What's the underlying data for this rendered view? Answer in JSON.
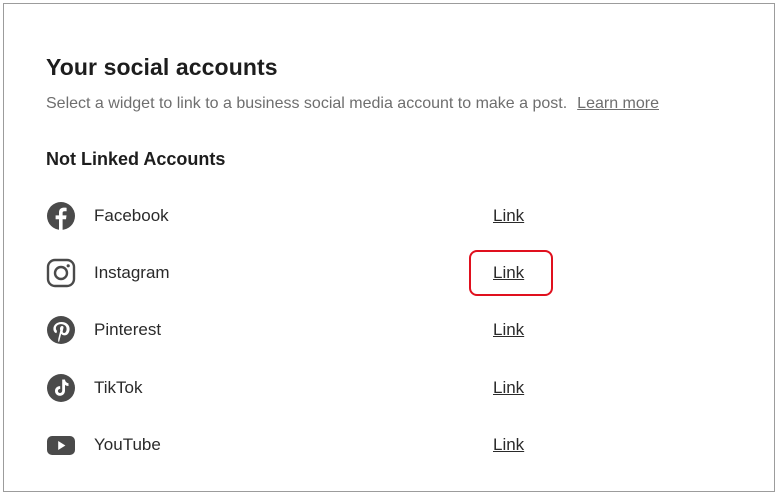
{
  "panel": {
    "title": "Your social accounts",
    "subtitle": "Select a widget to link to a business social media account to make a post.",
    "learn_more": "Learn more",
    "section_heading": "Not Linked Accounts"
  },
  "accounts": [
    {
      "name": "Facebook",
      "icon": "facebook-icon",
      "action": "Link"
    },
    {
      "name": "Instagram",
      "icon": "instagram-icon",
      "action": "Link"
    },
    {
      "name": "Pinterest",
      "icon": "pinterest-icon",
      "action": "Link"
    },
    {
      "name": "TikTok",
      "icon": "tiktok-icon",
      "action": "Link"
    },
    {
      "name": "YouTube",
      "icon": "youtube-icon",
      "action": "Link"
    }
  ],
  "colors": {
    "icon": "#4a4a4a",
    "highlight": "#e0101e",
    "muted_text": "#6e6e6e"
  }
}
